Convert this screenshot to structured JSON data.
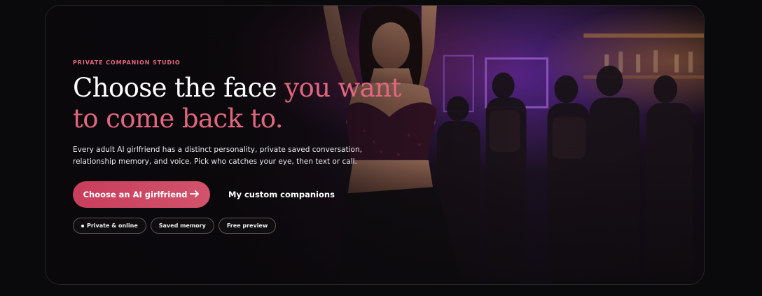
{
  "hero": {
    "eyebrow": "PRIVATE COMPANION STUDIO",
    "headline": {
      "line1_plain": "Choose the face ",
      "line1_accent": "you want",
      "line2_accent": "to come back to."
    },
    "description": "Every adult AI girlfriend has a distinct personality, private saved conversation, relationship memory, and voice. Pick who catches your eye, then text or call.",
    "primary_button": {
      "label": "Choose an AI girlfriend",
      "icon": "arrow-right-icon"
    },
    "secondary_link": {
      "label": "My custom companions"
    },
    "chips": [
      {
        "label": "Private & online",
        "icon": "dot-icon"
      },
      {
        "label": "Saved memory"
      },
      {
        "label": "Free preview"
      }
    ],
    "background_image": "photo of a woman dancing in a nightclub with a crowd and purple lights"
  },
  "colors": {
    "accent": "#e0677f",
    "button": "#cc4662",
    "page_background": "#0a090b",
    "text": "#ffffff"
  }
}
